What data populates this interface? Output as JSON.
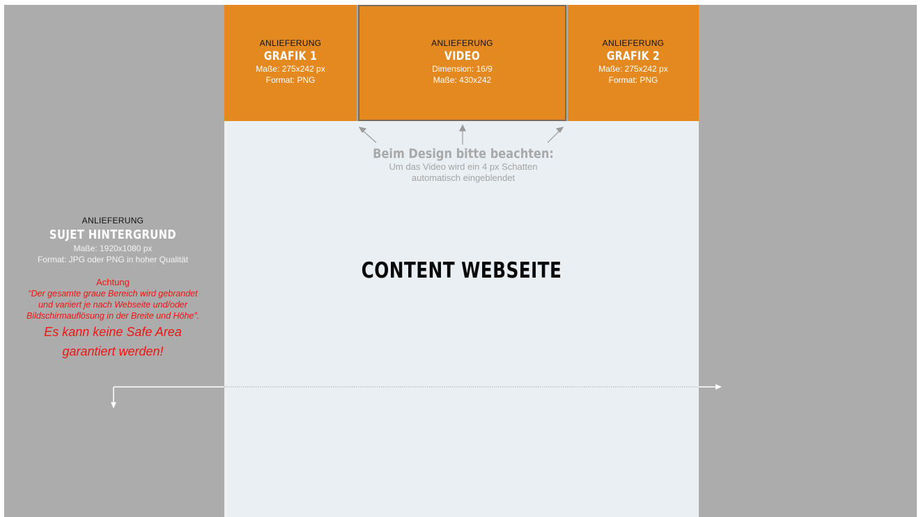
{
  "boxes": [
    {
      "kicker": "ANLIEFERUNG",
      "title": "GRAFIK 1",
      "spec1": "Maße: 275x242 px",
      "spec2": "Format: PNG"
    },
    {
      "kicker": "ANLIEFERUNG",
      "title": "VIDEO",
      "spec1": "Dimension: 16/9",
      "spec2": "Maße: 430x242"
    },
    {
      "kicker": "ANLIEFERUNG",
      "title": "GRAFIK 2",
      "spec1": "Maße: 275x242 px",
      "spec2": "Format: PNG"
    }
  ],
  "note": {
    "heading": "Beim Design bitte beachten:",
    "line1": "Um das Video wird ein 4 px Schatten",
    "line2": "automatisch eingeblendet"
  },
  "content": {
    "title": "CONTENT WEBSEITE"
  },
  "background_panel": {
    "kicker": "ANLIEFERUNG",
    "title": "SUJET HINTERGRUND",
    "spec1": "Maße: 1920x1080 px",
    "spec2": "Format: JPG oder PNG in hoher Qualität",
    "warning_heading": "Achtung",
    "warning_line1": "“Der gesamte graue Bereich wird gebrandet",
    "warning_line2": "und variiert je nach Webseite und/oder",
    "warning_line3": "Bildschirmauflösung in der Breite und Höhe”.",
    "warning_big1": "Es kann keine Safe Area",
    "warning_big2": "garantiert werden!"
  },
  "colors": {
    "background_gray": "#acacac",
    "content_area": "#eaeff3",
    "delivery_box_orange": "#e48820",
    "warning_red": "#f01414",
    "note_gray": "#a9a9a9"
  },
  "icons": [
    "arrow-up-left-icon",
    "arrow-up-icon",
    "arrow-up-right-icon",
    "arrow-right-icon",
    "arrow-down-icon"
  ]
}
